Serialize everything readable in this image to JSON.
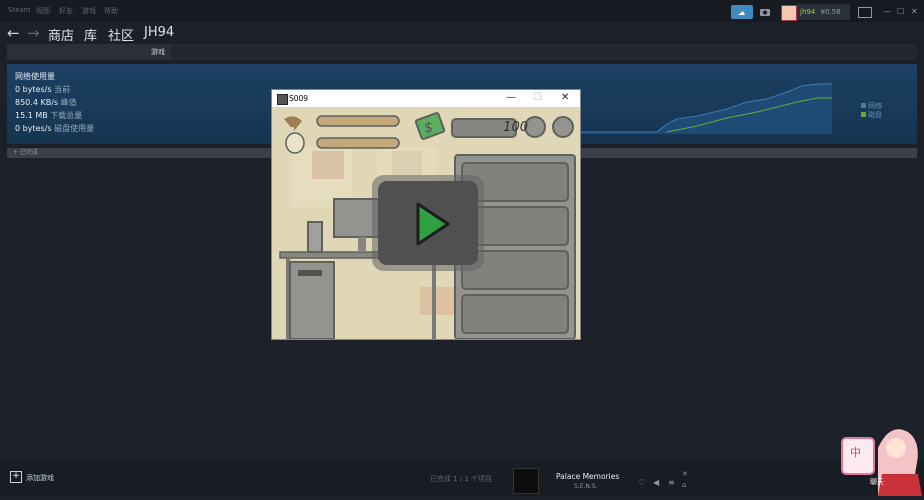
{
  "menu": [
    "Steam",
    "视图",
    "好友",
    "游戏",
    "帮助"
  ],
  "user": {
    "name": "jh94",
    "balance": "¥0.58"
  },
  "nav": {
    "back": "←",
    "forward": "→",
    "links": [
      "商店",
      "库",
      "社区",
      "JH94"
    ]
  },
  "tabbar": {
    "label": "游戏"
  },
  "network": {
    "title": "网络使用量",
    "rows": [
      {
        "value": "0 bytes/s",
        "label": "当前"
      },
      {
        "value": "850.4 KB/s",
        "label": "峰值"
      },
      {
        "value": "15.1 MB",
        "label": "下载总量"
      },
      {
        "value": "0 bytes/s",
        "label": "磁盘使用量"
      }
    ],
    "legend": [
      {
        "name": "网络",
        "color": "#3d7bb5"
      },
      {
        "name": "磁盘",
        "color": "#6aa93b"
      }
    ]
  },
  "collapse_label": "+ 已完成",
  "game_window": {
    "title": "S009",
    "coins": "100",
    "controls": [
      "—",
      "☐",
      "✕"
    ]
  },
  "bottom": {
    "add_game": "添加游戏",
    "download_status": "已完成 1 / 1 个项目",
    "song": "Palace Memories",
    "artist": "S.E.N.S."
  },
  "mascot": {
    "label": "中",
    "caption": "聊天"
  }
}
